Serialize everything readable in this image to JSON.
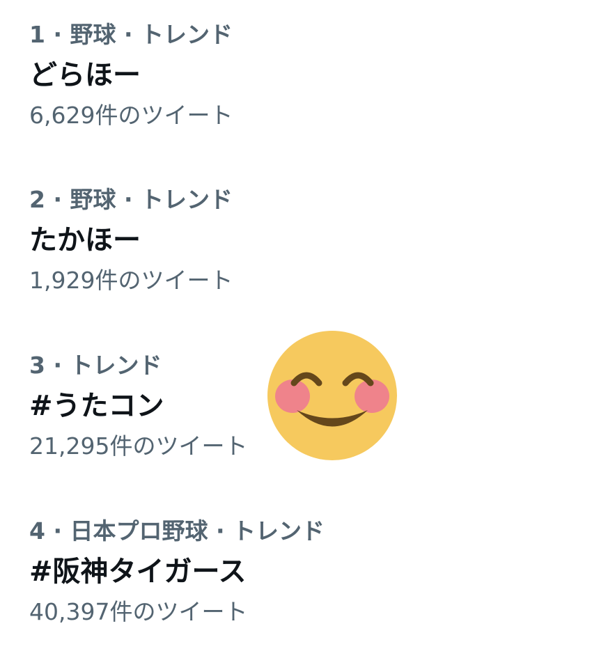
{
  "trends": [
    {
      "meta": "1 · 野球 · トレンド",
      "name": "どらほー",
      "count": "6,629件のツイート"
    },
    {
      "meta": "2 · 野球 · トレンド",
      "name": "たかほー",
      "count": "1,929件のツイート"
    },
    {
      "meta": "3 · トレンド",
      "name": "#うたコン",
      "count": "21,295件のツイート"
    },
    {
      "meta": "4 · 日本プロ野球 · トレンド",
      "name": "#阪神タイガース",
      "count": "40,397件のツイート"
    }
  ],
  "emoji": {
    "icon": "smiling-face-with-smiling-eyes-icon"
  },
  "colors": {
    "primary_text": "#0f1419",
    "secondary_text": "#536471",
    "emoji_face": "#f6c95e",
    "emoji_blush": "#ee7f8d",
    "emoji_features": "#65471b"
  }
}
